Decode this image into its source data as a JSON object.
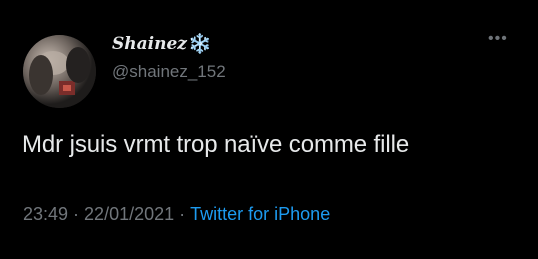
{
  "tweet": {
    "author": {
      "display_name": "Shainez",
      "name_emoji": "❄️",
      "handle": "@shainez_152",
      "avatar_icon": "profile-photo"
    },
    "more_label": "•••",
    "text": "Mdr jsuis vrmt trop naïve comme fille",
    "time": "23:49",
    "date": "22/01/2021",
    "separator": "·",
    "source": "Twitter for iPhone"
  },
  "colors": {
    "background": "#000000",
    "primary_text": "#e7e9ea",
    "secondary_text": "#71767b",
    "link": "#1d9bf0"
  }
}
